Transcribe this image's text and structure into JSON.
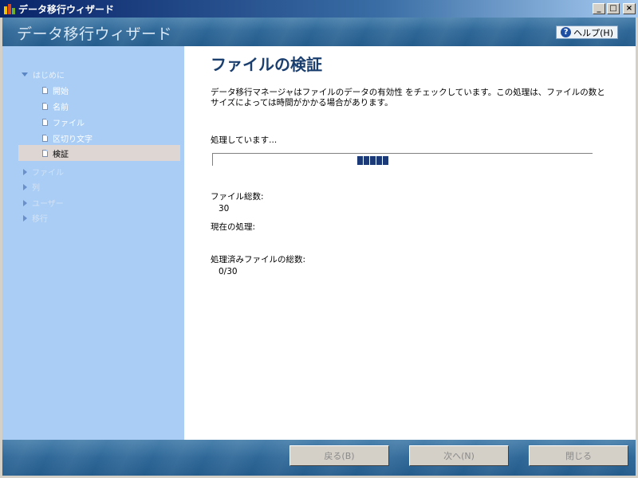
{
  "window": {
    "title": "データ移行ウィザード",
    "buttons": {
      "minimize": "_",
      "maximize": "□",
      "close": "×"
    }
  },
  "header": {
    "title": "データ移行ウィザード",
    "help_label": "ヘルプ(H)",
    "help_icon_glyph": "?"
  },
  "sidebar": {
    "groups": [
      {
        "label": "はじめに",
        "expanded": true,
        "items": [
          {
            "label": "開始"
          },
          {
            "label": "名前"
          },
          {
            "label": "ファイル"
          },
          {
            "label": "区切り文字"
          },
          {
            "label": "検証",
            "selected": true
          }
        ]
      },
      {
        "label": "ファイル"
      },
      {
        "label": "列"
      },
      {
        "label": "ユーザー"
      },
      {
        "label": "移行"
      }
    ]
  },
  "main": {
    "title": "ファイルの検証",
    "description": "データ移行マネージャはファイルのデータの有効性 をチェックしています。この処理は、ファイルの数とサイズによっては時間がかかる場合があります。",
    "processing_label": "処理しています...",
    "total_files_label": "ファイル総数:",
    "total_files_value": "30",
    "current_process_label": "現在の処理:",
    "processed_total_label": "処理済みファイルの総数:",
    "processed_total_value": "0/30"
  },
  "footer": {
    "back": "戻る(B)",
    "next": "次へ(N)",
    "close": "閉じる"
  },
  "colors": {
    "title_bar": "#0a246a",
    "header_band": "#2f6898",
    "sidebar_bg": "#a9cdf5",
    "selected_item": "#ddd6d3",
    "progress_block": "#1c3a78",
    "page_title": "#1a3e6e"
  }
}
